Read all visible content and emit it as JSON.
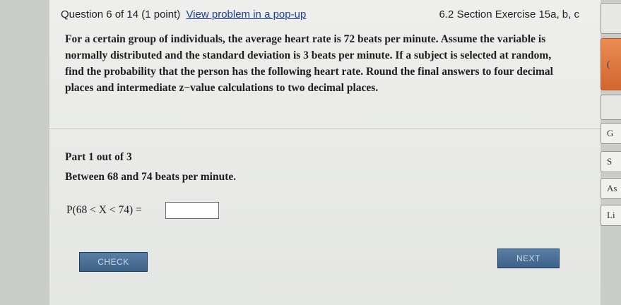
{
  "header": {
    "question_number": "Question 6 of 14 (1 point)",
    "popup_link": "View problem in a pop-up",
    "section": "6.2 Section Exercise 15a, b, c"
  },
  "problem": {
    "text": "For a certain group of individuals, the average heart rate is 72 beats per minute. Assume the variable is normally distributed and the standard deviation is 3 beats per minute. If a subject is selected at random, find the probability that the person has the following heart rate. Round the final answers to four decimal places and intermediate z−value calculations to two decimal places."
  },
  "part": {
    "label": "Part 1 out of 3",
    "question": "Between 68 and 74 beats per minute.",
    "formula": "P(68 < X < 74) =",
    "answer_value": ""
  },
  "buttons": {
    "check": "CHECK",
    "next": "NEXT"
  },
  "sidebar": {
    "tabs": [
      "",
      "(",
      "",
      "G",
      "S",
      "As",
      "Li"
    ]
  }
}
